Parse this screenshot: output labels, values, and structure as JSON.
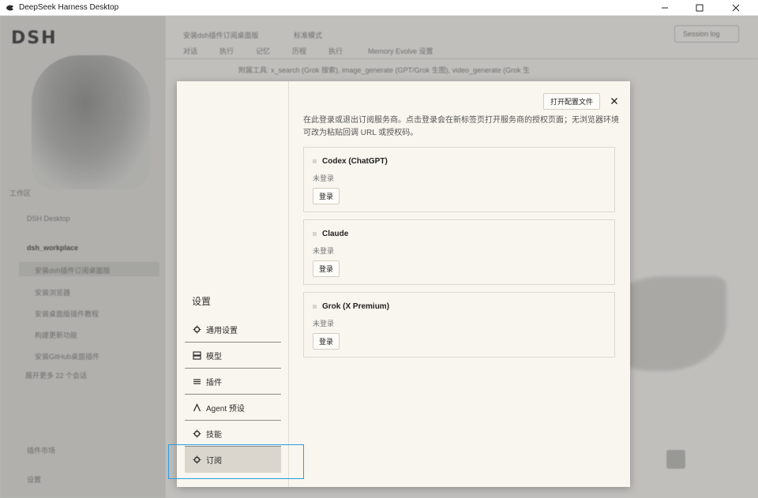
{
  "window": {
    "title": "DeepSeek Harness Desktop",
    "minimize": "—",
    "maximize": "☐",
    "close": "✕"
  },
  "background": {
    "logo": "DSH",
    "workspace_label": "工作区",
    "project_1": "DSH Desktop",
    "project_2": "dsh_workplace",
    "sessions": [
      "安装dsh插件订阅桌面版",
      "安装浏览器",
      "安装桌面版插件教程",
      "构建更新功能",
      "安装GitHub桌面插件"
    ],
    "more_sessions": "展开更多 22 个会话",
    "plugin_market": "插件市场",
    "settings": "设置",
    "header_title": "安装dsh插件订阅桌面版",
    "header_mode": "标准模式",
    "tabs": [
      "对话",
      "执行",
      "记忆",
      "历程",
      "执行",
      "Memory Evolve 设置"
    ],
    "session_log": "Session log",
    "tool_line": "附属工具: x_search (Grok 搜索), image_generate (GPT/Grok 生图), video_generate (Grok 生"
  },
  "dialog": {
    "settings_title": "设置",
    "nav": [
      {
        "label": "通用设置",
        "icon": "gear-icon"
      },
      {
        "label": "模型",
        "icon": "model-icon"
      },
      {
        "label": "插件",
        "icon": "plugin-icon"
      },
      {
        "label": "Agent 预设",
        "icon": "agent-icon"
      },
      {
        "label": "技能",
        "icon": "skill-icon"
      },
      {
        "label": "订阅",
        "icon": "subscription-icon"
      }
    ],
    "open_config": "打开配置文件",
    "close": "✕",
    "description": "在此登录或退出订阅服务商。点击登录会在新标签页打开服务商的授权页面；无浏览器环境可改为粘贴回调 URL 或授权码。",
    "providers": [
      {
        "name": "Codex (ChatGPT)",
        "status": "未登录",
        "login": "登录"
      },
      {
        "name": "Claude",
        "status": "未登录",
        "login": "登录"
      },
      {
        "name": "Grok (X Premium)",
        "status": "未登录",
        "login": "登录"
      }
    ]
  }
}
